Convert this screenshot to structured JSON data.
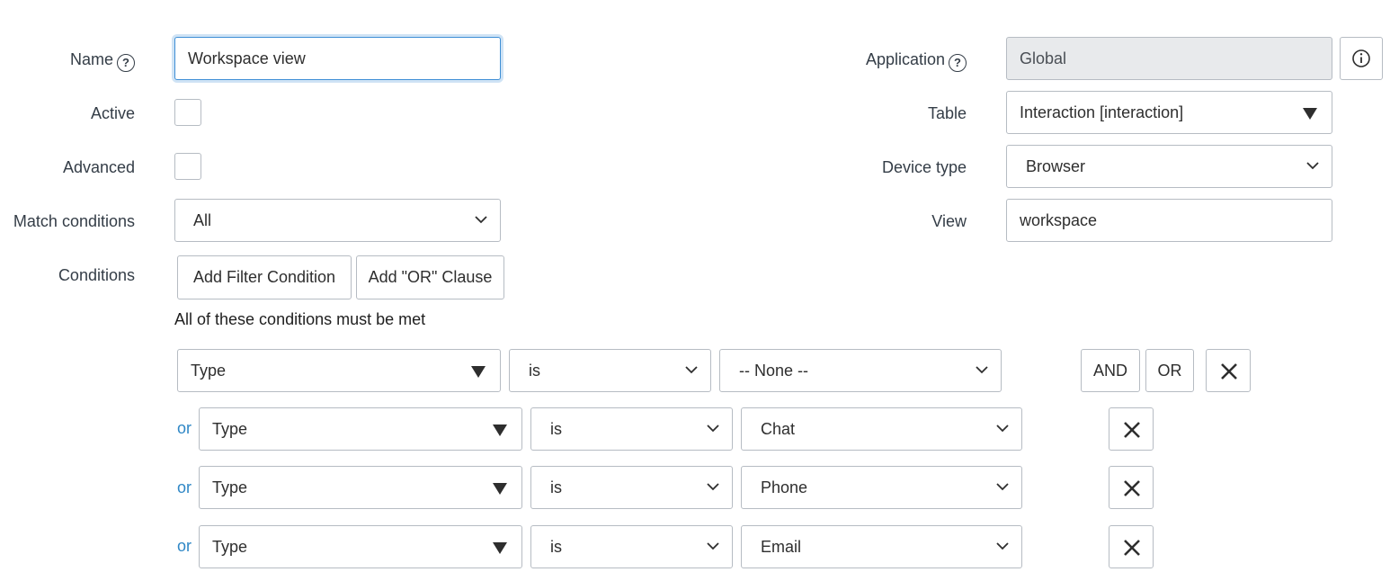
{
  "form": {
    "name_label": "Name",
    "name_value": "Workspace view",
    "active_label": "Active",
    "advanced_label": "Advanced",
    "match_label": "Match conditions",
    "match_value": "All",
    "conditions_label": "Conditions",
    "application_label": "Application",
    "application_value": "Global",
    "table_label": "Table",
    "table_value": "Interaction [interaction]",
    "device_label": "Device type",
    "device_value": "Browser",
    "view_label": "View",
    "view_value": "workspace"
  },
  "conditions": {
    "add_filter_label": "Add Filter Condition",
    "add_or_label": "Add \"OR\" Clause",
    "heading": "All of these conditions must be met",
    "and_label": "AND",
    "or_label": "OR",
    "or_prefix": "or",
    "rows": [
      {
        "field": "Type",
        "operator": "is",
        "value": "-- None --"
      },
      {
        "field": "Type",
        "operator": "is",
        "value": "Chat"
      },
      {
        "field": "Type",
        "operator": "is",
        "value": "Phone"
      },
      {
        "field": "Type",
        "operator": "is",
        "value": "Email"
      }
    ]
  },
  "colors": {
    "accent": "#2f87c6",
    "focus_border": "#3f8fd6",
    "readonly_bg": "#e8eaec"
  },
  "icons": [
    "help-icon",
    "info-icon",
    "dropdown-triangle-icon",
    "chevron-down-icon",
    "close-icon"
  ]
}
